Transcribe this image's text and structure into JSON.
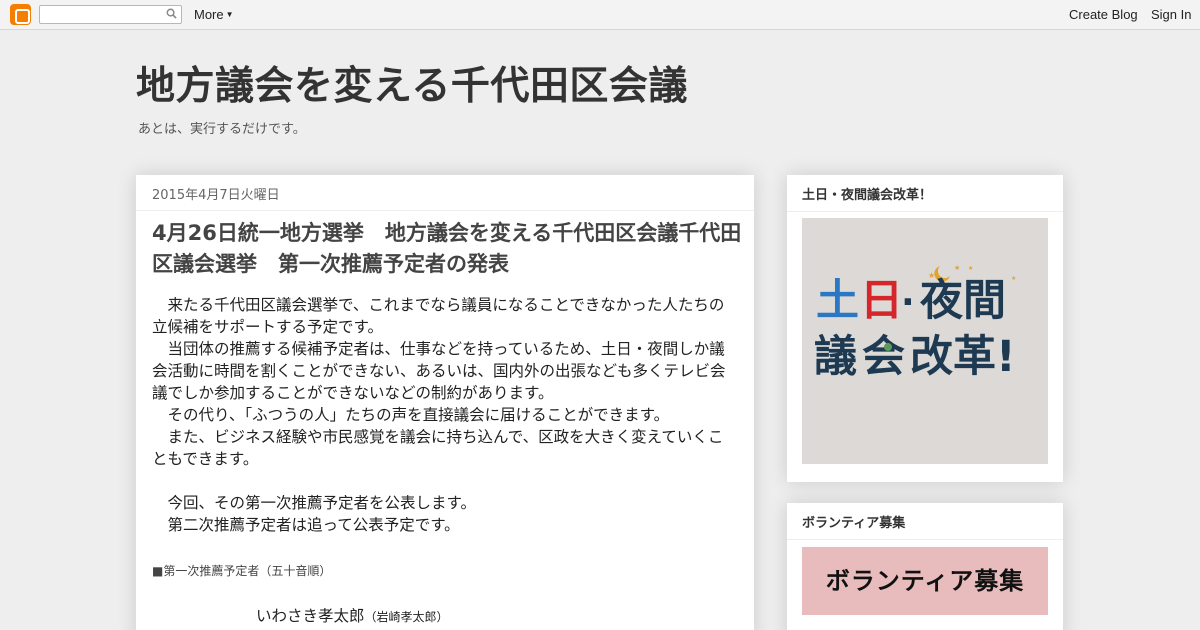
{
  "navbar": {
    "more_label": "More",
    "create_blog": "Create Blog",
    "sign_in": "Sign In"
  },
  "header": {
    "title": "地方議会を変える千代田区会議",
    "description": "あとは、実行するだけです。"
  },
  "post": {
    "date": "2015年4月7日火曜日",
    "title": "4月26日統一地方選挙　地方議会を変える千代田区会議千代田区議会選挙　第一次推薦予定者の発表",
    "paragraphs": [
      "　来たる千代田区議会選挙で、これまでなら議員になることできなかった人たちの立候補をサポートする予定です。",
      "　当団体の推薦する候補予定者は、仕事などを持っているため、土日・夜間しか議会活動に時間を割くことができない、あるいは、国内外の出張なども多くテレビ会議でしか参加することができないなどの制約があります。",
      "　その代り、「ふつうの人」たちの声を直接議会に届けることができます。",
      "　また、ビジネス経験や市民感覚を議会に持ち込んで、区政を大きく変えていくこともできます。",
      "",
      "　今回、その第一次推薦予定者を公表します。",
      "　第二次推薦予定者は追って公表予定です。"
    ],
    "subhead": "■第一次推薦予定者（五十音順）",
    "candidate_name": "いわさき孝太郎",
    "candidate_kanji": "（岩崎孝太郎）"
  },
  "sidebar": {
    "widget1_title": "土日・夜間議会改革！",
    "widget1_banner_line1": "土日·夜間",
    "widget1_banner_line2": "議会改革!",
    "widget2_title": "ボランティア募集",
    "widget2_banner": "ボランティア募集"
  },
  "colors": {
    "accent_orange": "#f57d00",
    "banner_blue": "#2a78c4",
    "banner_red": "#d4262b",
    "banner_navy": "#1d3a52",
    "banner_green": "#5a9a5a",
    "banner_star": "#e3a32b",
    "volunteer_bg": "#e8bcbc"
  }
}
